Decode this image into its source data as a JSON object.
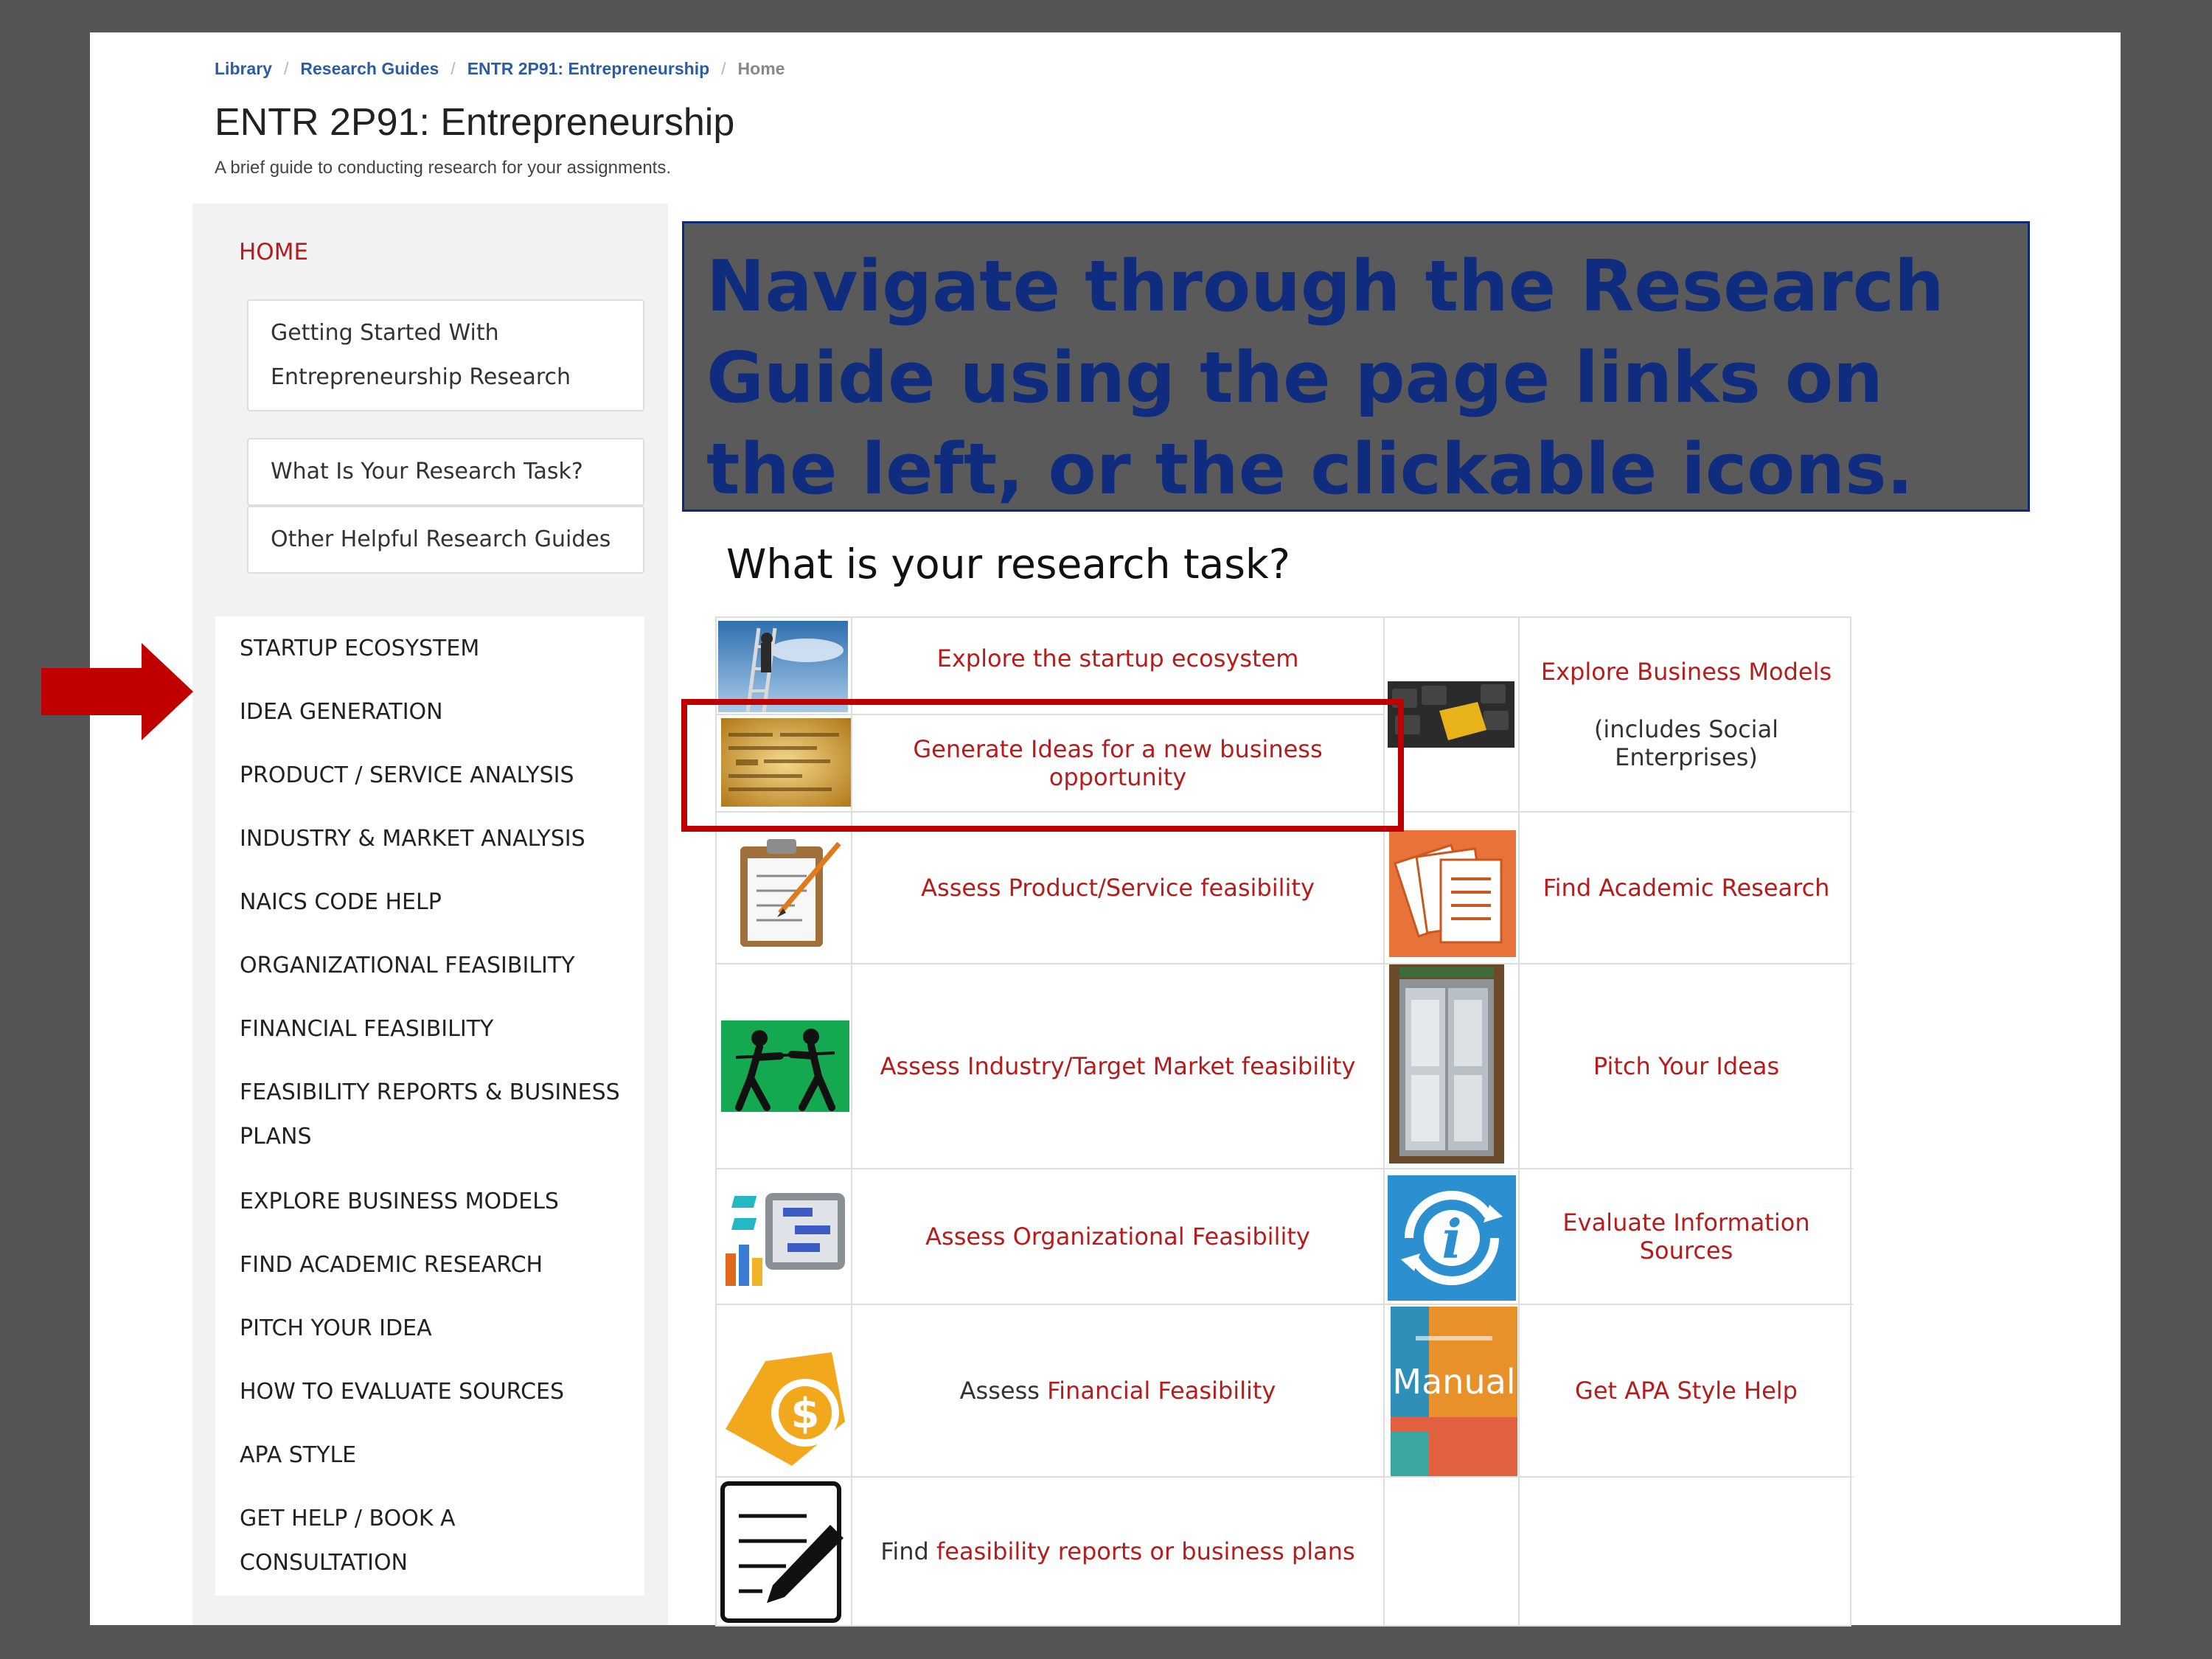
{
  "breadcrumb": {
    "items": [
      "Library",
      "Research Guides",
      "ENTR 2P91: Entrepreneurship"
    ],
    "current": "Home"
  },
  "page": {
    "title": "ENTR 2P91: Entrepreneurship",
    "description": "A brief guide to conducting research for your assignments."
  },
  "sidebar": {
    "home": "HOME",
    "subitems": [
      "Getting Started With Entrepreneurship Research",
      "What Is Your Research Task?",
      "Other Helpful Research Guides"
    ],
    "items": [
      "STARTUP ECOSYSTEM",
      "IDEA GENERATION",
      "PRODUCT / SERVICE ANALYSIS",
      "INDUSTRY & MARKET ANALYSIS",
      "NAICS CODE HELP",
      "ORGANIZATIONAL FEASIBILITY",
      "FINANCIAL FEASIBILITY",
      "FEASIBILITY REPORTS & BUSINESS PLANS",
      "EXPLORE BUSINESS MODELS",
      "FIND ACADEMIC RESEARCH",
      "PITCH YOUR IDEA",
      "HOW TO EVALUATE SOURCES",
      "APA STYLE",
      "GET HELP / BOOK A CONSULTATION"
    ]
  },
  "banner": {
    "text": "Navigate through the Research Guide using the page links on the left, or the clickable icons."
  },
  "tasks": {
    "heading": "What is your research task?",
    "left": [
      {
        "link": "Explore the startup ecosystem",
        "icon": "ladder-lookout-icon"
      },
      {
        "link": "Generate Ideas for a new business opportunity",
        "icon": "idea-dictionary-icon"
      },
      {
        "link": "Assess Product/Service feasibility",
        "icon": "clipboard-icon"
      },
      {
        "link": "Assess Industry/Target Market feasibility",
        "icon": "tug-of-war-icon"
      },
      {
        "link": "Assess Organizational Feasibility",
        "icon": "org-chart-icon"
      },
      {
        "prefix": "Assess ",
        "link": "Financial Feasibility",
        "icon": "dollar-coin-icon"
      },
      {
        "prefix": "Find ",
        "link": "feasibility reports or business plans",
        "icon": "edit-document-icon"
      }
    ],
    "right": [
      {
        "link": "Explore Business Models",
        "note": "(includes Social Enterprises)",
        "icon": "keyboard-key-icon"
      },
      {
        "link": "Find Academic Research",
        "icon": "documents-icon"
      },
      {
        "link": "Pitch Your Ideas",
        "icon": "elevator-icon"
      },
      {
        "link": "Evaluate Information Sources",
        "icon": "info-cycle-icon"
      },
      {
        "link": "Get APA Style Help",
        "icon": "apa-manual-icon",
        "icon_text": "Manual"
      }
    ]
  },
  "colors": {
    "link": "#b71c1c",
    "banner_text": "#0f2c7e",
    "banner_bg": "#5a5a5a",
    "annotation": "#c00000",
    "breadcrumb": "#2a5ca8"
  }
}
